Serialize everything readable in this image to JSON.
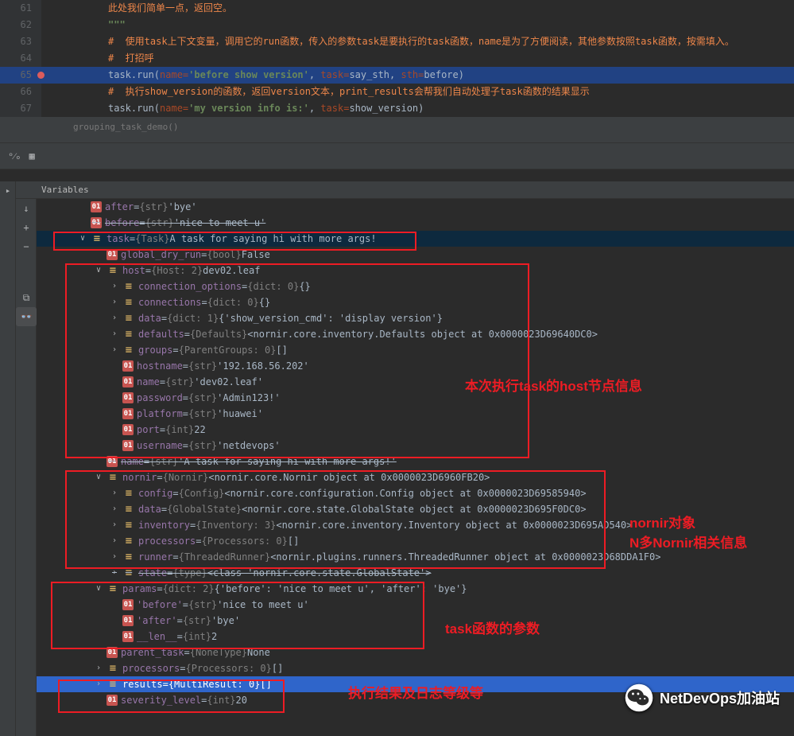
{
  "code": {
    "l61": {
      "num": "61",
      "text": "此处我们简单一点，返回空。"
    },
    "l62": {
      "num": "62",
      "text": "\"\"\""
    },
    "l63": {
      "num": "63",
      "text": "#  使用task上下文变量，调用它的run函数，传入的参数task是要执行的task函数，name是为了方便阅读，其他参数按照task函数，按需填入。"
    },
    "l64": {
      "num": "64",
      "text": "#  打招呼"
    },
    "l65": {
      "num": "65",
      "run": "task.run(",
      "p1": "name=",
      "s1": "'before show version'",
      "c1": ", ",
      "p2": "task=",
      "v2": "say_sth, ",
      "p3": "sth=",
      "v3": "before)"
    },
    "l66": {
      "num": "66",
      "text": "#  执行show_version的函数，返回version文本，print_results会帮我们自动处理子task函数的结果显示"
    },
    "l67": {
      "num": "67",
      "run": "task.run(",
      "p1": "name=",
      "s1": "'my version info is:'",
      "c1": ", ",
      "p2": "task=",
      "v2": "show_version)"
    }
  },
  "stack": "grouping_task_demo()",
  "vars_title": "Variables",
  "tree": {
    "after": {
      "name": "after",
      "type": "{str}",
      "val": "'bye'"
    },
    "before": {
      "name": "before",
      "type": "{str}",
      "val": "'nice to meet u'"
    },
    "task": {
      "name": "task",
      "type": "{Task}",
      "val": "A task for saying hi with more args!"
    },
    "global_dry_run": {
      "name": "global_dry_run",
      "type": "{bool}",
      "val": "False"
    },
    "host": {
      "name": "host",
      "type": "{Host: 2}",
      "val": "dev02.leaf"
    },
    "connection_options": {
      "name": "connection_options",
      "type": "{dict: 0}",
      "val": "{}"
    },
    "connections": {
      "name": "connections",
      "type": "{dict: 0}",
      "val": "{}"
    },
    "data": {
      "name": "data",
      "type": "{dict: 1}",
      "val": "{'show_version_cmd': 'display version'}"
    },
    "defaults": {
      "name": "defaults",
      "type": "{Defaults}",
      "val": "<nornir.core.inventory.Defaults object at 0x0000023D69640DC0>"
    },
    "groups": {
      "name": "groups",
      "type": "{ParentGroups: 0}",
      "val": "[]"
    },
    "hostname": {
      "name": "hostname",
      "type": "{str}",
      "val": "'192.168.56.202'"
    },
    "hname": {
      "name": "name",
      "type": "{str}",
      "val": "'dev02.leaf'"
    },
    "password": {
      "name": "password",
      "type": "{str}",
      "val": "'Admin123!'"
    },
    "platform": {
      "name": "platform",
      "type": "{str}",
      "val": "'huawei'"
    },
    "port": {
      "name": "port",
      "type": "{int}",
      "val": "22"
    },
    "username": {
      "name": "username",
      "type": "{str}",
      "val": "'netdevops'"
    },
    "tname": {
      "name": "name",
      "type": "{str}",
      "val": "'A task for saying hi with more args!'"
    },
    "nornir": {
      "name": "nornir",
      "type": "{Nornir}",
      "val": "<nornir.core.Nornir object at 0x0000023D6960FB20>"
    },
    "config": {
      "name": "config",
      "type": "{Config}",
      "val": "<nornir.core.configuration.Config object at 0x0000023D69585940>"
    },
    "ndata": {
      "name": "data",
      "type": "{GlobalState}",
      "val": "<nornir.core.state.GlobalState object at 0x0000023D695F0DC0>"
    },
    "inventory": {
      "name": "inventory",
      "type": "{Inventory: 3}",
      "val": "<nornir.core.inventory.Inventory object at 0x0000023D695AD540>"
    },
    "nprocessors": {
      "name": "processors",
      "type": "{Processors: 0}",
      "val": "[]"
    },
    "runner": {
      "name": "runner",
      "type": "{ThreadedRunner}",
      "val": "<nornir.plugins.runners.ThreadedRunner object at 0x0000023D68DDA1F0>"
    },
    "state": {
      "name": "state",
      "type": "{type}",
      "val": "<class 'nornir.core.state.GlobalState'>"
    },
    "params": {
      "name": "params",
      "type": "{dict: 2}",
      "val": "{'before': 'nice to meet u', 'after': 'bye'}"
    },
    "pbefore": {
      "name": "'before'",
      "type": "{str}",
      "val": "'nice to meet u'"
    },
    "pafter": {
      "name": "'after'",
      "type": "{str}",
      "val": "'bye'"
    },
    "plen": {
      "name": "__len__",
      "type": "{int}",
      "val": "2"
    },
    "parent_task": {
      "name": "parent_task",
      "type": "{NoneType}",
      "val": "None"
    },
    "pprocessors": {
      "name": "processors",
      "type": "{Processors: 0}",
      "val": "[]"
    },
    "results": {
      "name": "results",
      "type": "{MultiResult: 0}",
      "val": "[]"
    },
    "severity_level": {
      "name": "severity_level",
      "type": "{int}",
      "val": "20"
    }
  },
  "annotations": {
    "host_info": "本次执行task的host节点信息",
    "nornir1": "nornir对象",
    "nornir2": "N多Nornir相关信息",
    "params": "task函数的参数",
    "results": "执行结果及日志等级等"
  },
  "watermark": "NetDevOps加油站"
}
